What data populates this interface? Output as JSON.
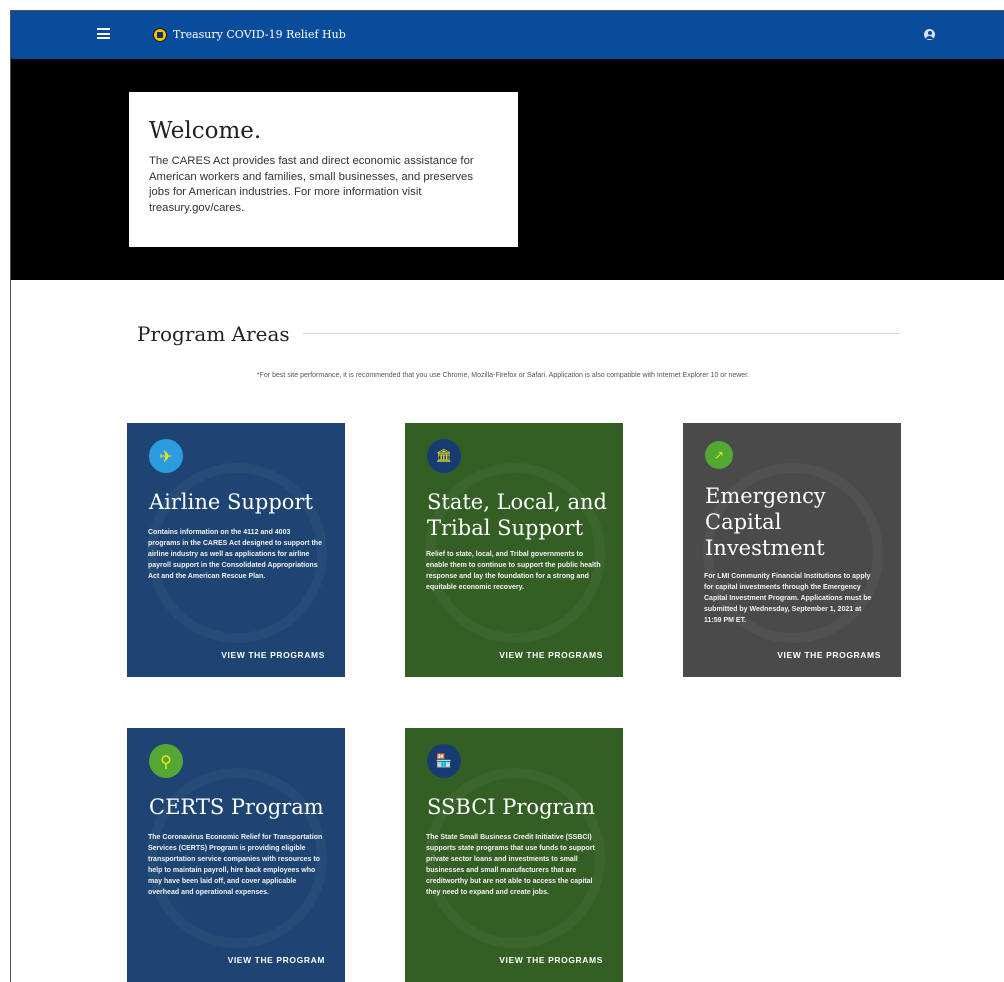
{
  "header": {
    "title": "Treasury COVID-19 Relief Hub",
    "menu_icon": "hamburger-icon",
    "logo_icon": "treasury-seal-icon",
    "user_icon": "account-icon",
    "bar_color": "#0a4c9c"
  },
  "hero": {
    "title": "Welcome.",
    "body": "The CARES Act provides fast and direct economic assistance for American workers and families, small businesses, and preserves jobs for American industries. For more information visit treasury.gov/cares."
  },
  "programs": {
    "title": "Program Areas",
    "notice": "*For best site performance, it is recommended that you use Chrome, Mozilla-Firefox or Safari. Application is also compatible with Internet Explorer 10 or newer.",
    "cards": [
      {
        "title": "Airline Support",
        "description": "Contains information on the 4112 and 4003 programs in the CARES Act designed to support the airline industry as well as applications for airline payroll support in the Consolidated Appropriations Act and the American Rescue Plan.",
        "link": "VIEW THE PROGRAMS",
        "icon": "airplane-icon",
        "color": "#1d4472",
        "icon_color": "#2d9be0"
      },
      {
        "title": "State, Local, and Tribal Support",
        "description": "Relief to state, local, and Tribal governments to enable them to continue to support the public health response and lay the foundation for a strong and equitable economic recovery.",
        "link": "VIEW THE PROGRAMS",
        "icon": "government-building-icon",
        "color": "#345f24",
        "icon_color": "#163c73"
      },
      {
        "title": "Emergency Capital Investment",
        "description": "For LMI Community Financial Institutions to apply for capital investments through the Emergency Capital Investment Program. Applications must be submitted by Wednesday, September 1, 2021 at 11:59 PM ET.",
        "link": "VIEW THE PROGRAMS",
        "icon": "growth-chart-icon",
        "color": "#4a4a4a",
        "icon_color": "#52a832"
      },
      {
        "title": "CERTS Program",
        "description": "The Coronavirus Economic Relief for Transportation Services (CERTS) Program is providing eligible transportation service companies with resources to help to maintain payroll, hire back employees who may have been laid off, and cover applicable overhead and operational expenses.",
        "link": "VIEW THE PROGRAM",
        "icon": "route-pin-icon",
        "color": "#1d4472",
        "icon_color": "#52a832"
      },
      {
        "title": "SSBCI Program",
        "description": "The State Small Business Credit Initiative (SSBCI) supports state programs that use funds to support private sector loans and investments to small businesses and small manufacturers that are creditworthy but are not able to access the capital they need to expand and create jobs.",
        "link": "VIEW THE PROGRAMS",
        "icon": "storefront-icon",
        "color": "#345f24",
        "icon_color": "#163c73"
      }
    ]
  }
}
